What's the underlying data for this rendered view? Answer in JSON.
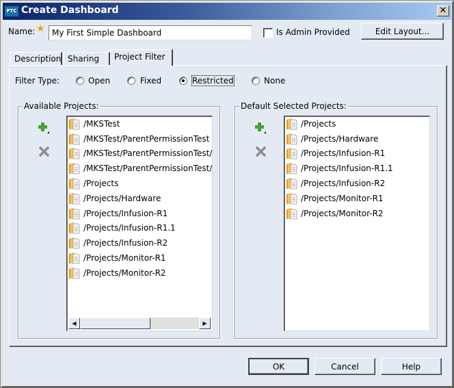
{
  "window": {
    "app_badge": "PTC",
    "title": "Create Dashboard",
    "close_glyph": "✕"
  },
  "form": {
    "name_label": "Name:",
    "required_marker": "★",
    "name_value": "My First Simple Dashboard",
    "is_admin_provided_label": "Is Admin Provided",
    "is_admin_provided_checked": false,
    "edit_layout_label": "Edit Layout..."
  },
  "tabs": [
    {
      "label": "Description",
      "active": false
    },
    {
      "label": "Sharing",
      "active": false
    },
    {
      "label": "Project Filter",
      "active": true
    }
  ],
  "project_filter": {
    "filter_type_label": "Filter Type:",
    "options": [
      {
        "label": "Open",
        "selected": false
      },
      {
        "label": "Fixed",
        "selected": false
      },
      {
        "label": "Restricted",
        "selected": true
      },
      {
        "label": "None",
        "selected": false
      }
    ],
    "available": {
      "legend": "Available Projects:",
      "add_icon": "plus-icon",
      "remove_icon": "x-icon",
      "items": [
        "/MKSTest",
        "/MKSTest/ParentPermissionTest",
        "/MKSTest/ParentPermissionTest/",
        "/MKSTest/ParentPermissionTest/",
        "/Projects",
        "/Projects/Hardware",
        "/Projects/Infusion-R1",
        "/Projects/Infusion-R1.1",
        "/Projects/Infusion-R2",
        "/Projects/Monitor-R1",
        "/Projects/Monitor-R2"
      ],
      "scroll_left_glyph": "◀",
      "scroll_right_glyph": "▶"
    },
    "default_selected": {
      "legend": "Default Selected Projects:",
      "add_icon": "plus-icon",
      "remove_icon": "x-icon",
      "items": [
        "/Projects",
        "/Projects/Hardware",
        "/Projects/Infusion-R1",
        "/Projects/Infusion-R1.1",
        "/Projects/Infusion-R2",
        "/Projects/Monitor-R1",
        "/Projects/Monitor-R2"
      ]
    }
  },
  "footer": {
    "ok_label": "OK",
    "cancel_label": "Cancel",
    "help_label": "Help"
  },
  "colors": {
    "title_gradient_start": "#0a246a",
    "title_gradient_end": "#a6caf0",
    "dialog_bg": "#e4eaf4",
    "add_icon": "#4aa02c",
    "remove_icon": "#8c8c8c",
    "folder_icon": "#f2b33d",
    "required_star": "#f0a010"
  }
}
